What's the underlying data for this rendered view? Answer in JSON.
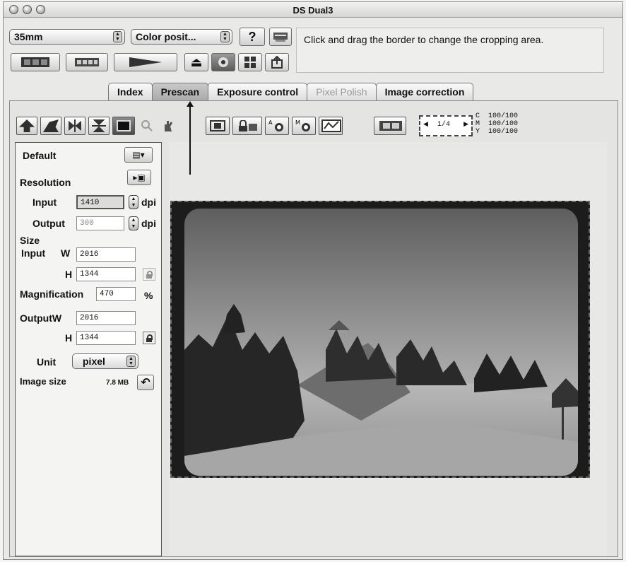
{
  "window": {
    "title": "DS Dual3"
  },
  "toolbar": {
    "film_type": "35mm",
    "color_mode": "Color posit...",
    "help_icon": "question-mark-icon",
    "message": "Click and drag the border to change the cropping area."
  },
  "tabs": [
    {
      "label": "Index",
      "state": "normal"
    },
    {
      "label": "Prescan",
      "state": "active"
    },
    {
      "label": "Exposure control",
      "state": "normal"
    },
    {
      "label": "Pixel Polish",
      "state": "disabled"
    },
    {
      "label": "Image correction",
      "state": "normal"
    }
  ],
  "frame_counter": {
    "value": "1/4"
  },
  "levels": [
    {
      "channel": "C",
      "value": "100/100"
    },
    {
      "channel": "M",
      "value": "100/100"
    },
    {
      "channel": "Y",
      "value": "100/100"
    }
  ],
  "sidebar": {
    "default_label": "Default",
    "resolution_label": "Resolution",
    "input_label": "Input",
    "input_dpi": "1410",
    "output_label": "Output",
    "output_dpi": "300",
    "dpi_unit": "dpi",
    "size_label": "Size",
    "size_input_label": "Input",
    "w_label": "W",
    "h_label": "H",
    "input_w": "2016",
    "input_h": "1344",
    "magnification_label": "Magnification",
    "magnification_value": "470",
    "percent_unit": "%",
    "output_w_label": "OutputW",
    "output_w": "2016",
    "output_h": "1344",
    "unit_label": "Unit",
    "unit_value": "pixel",
    "image_size_label": "Image size",
    "image_size_value": "7.8 MB"
  },
  "colors": {
    "window_bg": "#e9e9e7",
    "active_tab": "#b5b5b5",
    "preview_frame": "#1c1c1c"
  }
}
